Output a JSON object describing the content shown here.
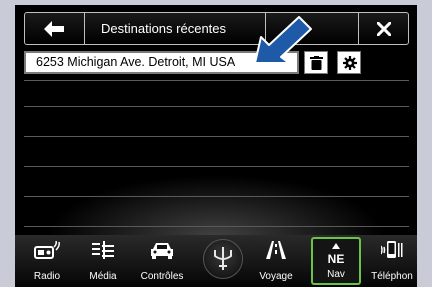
{
  "header": {
    "title": "Destinations récentes"
  },
  "destination": {
    "address": "6253 Michigan Ave. Detroit, MI USA"
  },
  "nav": {
    "items": [
      {
        "label": "Radio",
        "icon": "radio-icon"
      },
      {
        "label": "Média",
        "icon": "media-icon"
      },
      {
        "label": "Contrôles",
        "icon": "car-controls-icon"
      },
      {
        "label": "",
        "icon": "trident-logo-icon"
      },
      {
        "label": "Voyage",
        "icon": "road-icon"
      },
      {
        "label": "Nav",
        "icon": "compass-icon",
        "heading": "NE",
        "active": true
      },
      {
        "label": "Téléphon",
        "icon": "phone-icon"
      }
    ]
  },
  "colors": {
    "accent_active": "#6cc24a",
    "callout_arrow": "#1e5aa8"
  }
}
